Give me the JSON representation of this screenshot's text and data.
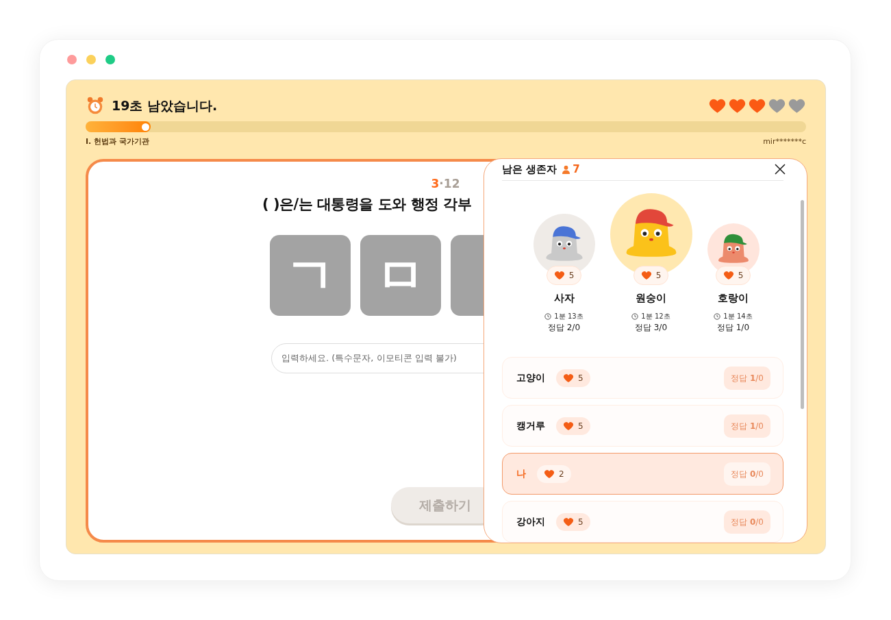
{
  "window": {
    "controls": [
      {
        "color": "#fe9b9b"
      },
      {
        "color": "#fbd15b"
      },
      {
        "color": "#1fcc86"
      }
    ]
  },
  "header": {
    "timer": "19초 남았습니다.",
    "lives": [
      {
        "filled": true
      },
      {
        "filled": true
      },
      {
        "filled": true
      },
      {
        "filled": false
      },
      {
        "filled": false
      }
    ],
    "progress": {
      "level": 0.09
    },
    "chapter": "Ⅰ. 헌법과 국가기관",
    "user": "mir*******c"
  },
  "question": {
    "counter_current": "3",
    "counter_separator": "·",
    "counter_total": "12",
    "text": "( )은/는 대통령을 도와 행정 각부",
    "tiles": [
      {
        "kind": "letter",
        "letter": "ㄱ"
      },
      {
        "kind": "letter",
        "letter": "ㅁ"
      },
      {
        "kind": "covered"
      }
    ],
    "answer": {
      "placeholder": "입력하세요. (특수문자, 이모티콘 입력 불가)"
    },
    "submit": {
      "label": "제출하기",
      "disabled": true
    }
  },
  "survivors": {
    "title": "남은 생존자",
    "count": "7",
    "podium": [
      {
        "kind": "second",
        "name": "사자",
        "lives": "5",
        "time": "1분 13초",
        "score": "정답 2/0",
        "color": "#c9c9c9"
      },
      {
        "kind": "first",
        "name": "원숭이",
        "lives": "5",
        "time": "1분 12초",
        "score": "정답 3/0",
        "color": "#fbc21a"
      },
      {
        "kind": "third",
        "name": "호랑이",
        "lives": "5",
        "time": "1분 14초",
        "score": "정답 1/0",
        "color": "#ec8a6c"
      }
    ],
    "rows": [
      {
        "name": "고양이",
        "lives": "5",
        "score": "정답 **1**/0",
        "selected": false
      },
      {
        "name": "캥거루",
        "lives": "5",
        "score": "정답 **1**/0",
        "selected": false
      },
      {
        "name": "나",
        "lives": "2",
        "score": "정답 **0**/0",
        "selected": true
      },
      {
        "name": "강아지",
        "lives": "5",
        "score": "정답 **0**/0",
        "selected": false
      }
    ]
  }
}
